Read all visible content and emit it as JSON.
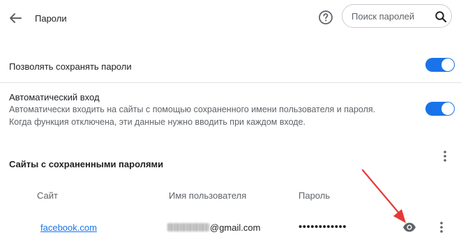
{
  "header": {
    "title": "Пароли",
    "search_placeholder": "Поиск паролей"
  },
  "settings": {
    "offer_save": {
      "label": "Позволять сохранять пароли",
      "enabled": true
    },
    "auto_signin": {
      "label": "Автоматический вход",
      "desc_line1": "Автоматически входить на сайты с помощью сохраненного имени пользователя и пароля.",
      "desc_line2": "Когда функция отключена, эти данные нужно вводить при каждом входе.",
      "enabled": true
    }
  },
  "saved": {
    "section_title": "Сайты с сохраненными паролями",
    "columns": [
      "Сайт",
      "Имя пользователя",
      "Пароль"
    ],
    "rows": [
      {
        "site": "facebook.com",
        "username_visible_part": "@gmail.com",
        "password_mask": "••••••••••••"
      }
    ]
  },
  "icons": {
    "back": "arrow-back-icon",
    "help": "help-icon",
    "search": "search-icon",
    "more": "more-vert-icon",
    "show_password": "eye-icon"
  },
  "colors": {
    "accent": "#1a73e8",
    "annotation_arrow": "#e53935"
  }
}
